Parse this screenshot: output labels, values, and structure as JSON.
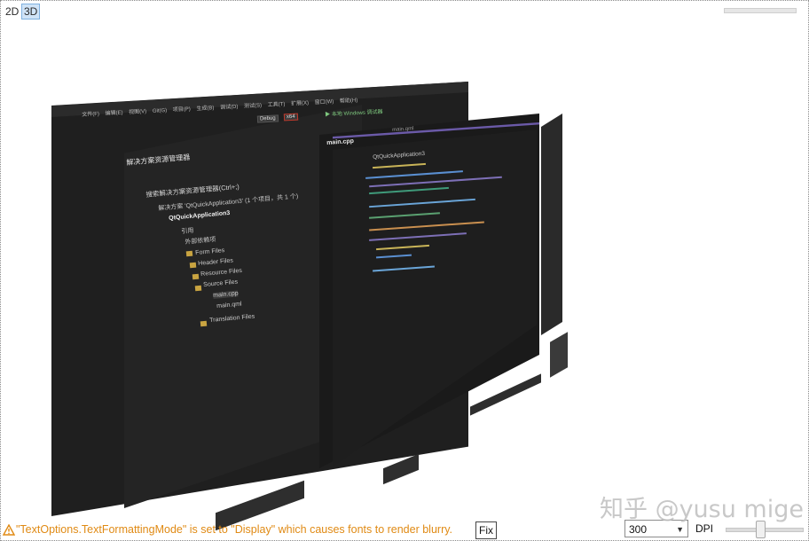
{
  "toolbar": {
    "mode_2d": "2D",
    "mode_3d": "3D"
  },
  "scene": {
    "menu_items": [
      "文件(F)",
      "编辑(E)",
      "视图(V)",
      "Git(G)",
      "项目(P)",
      "生成(B)",
      "调试(D)",
      "测试(S)",
      "工具(T)",
      "扩展(X)",
      "窗口(W)",
      "帮助(H)"
    ],
    "config": "Debug",
    "platform": "x64",
    "run_target": "本地 Windows 调试器",
    "solution_explorer_title": "解决方案资源管理器",
    "search_placeholder": "搜索解决方案资源管理器(Ctrl+;)",
    "tree": [
      "解决方案 'QtQuickApplication3' (1 个项目，共 1 个)",
      "QtQuickApplication3",
      "引用",
      "外部依赖项",
      "Form Files",
      "Header Files",
      "Resource Files",
      "Source Files",
      "main.cpp",
      "main.qml",
      "Translation Files"
    ],
    "editor_tab": "main.cpp",
    "editor_tab2": "main.qml",
    "code_header": "QtQuickApplication3"
  },
  "status": {
    "warning_text": "\"TextOptions.TextFormattingMode\" is set to \"Display\" which causes fonts to render blurry.",
    "fix_label": "Fix",
    "dpi_value": "300",
    "dpi_label": "DPI"
  },
  "watermark": "知乎 @yusu mige",
  "colors": {
    "warning": "#e08a14",
    "selected_mode": "#cfe3f7",
    "editor_border": "#6b5aa8"
  }
}
